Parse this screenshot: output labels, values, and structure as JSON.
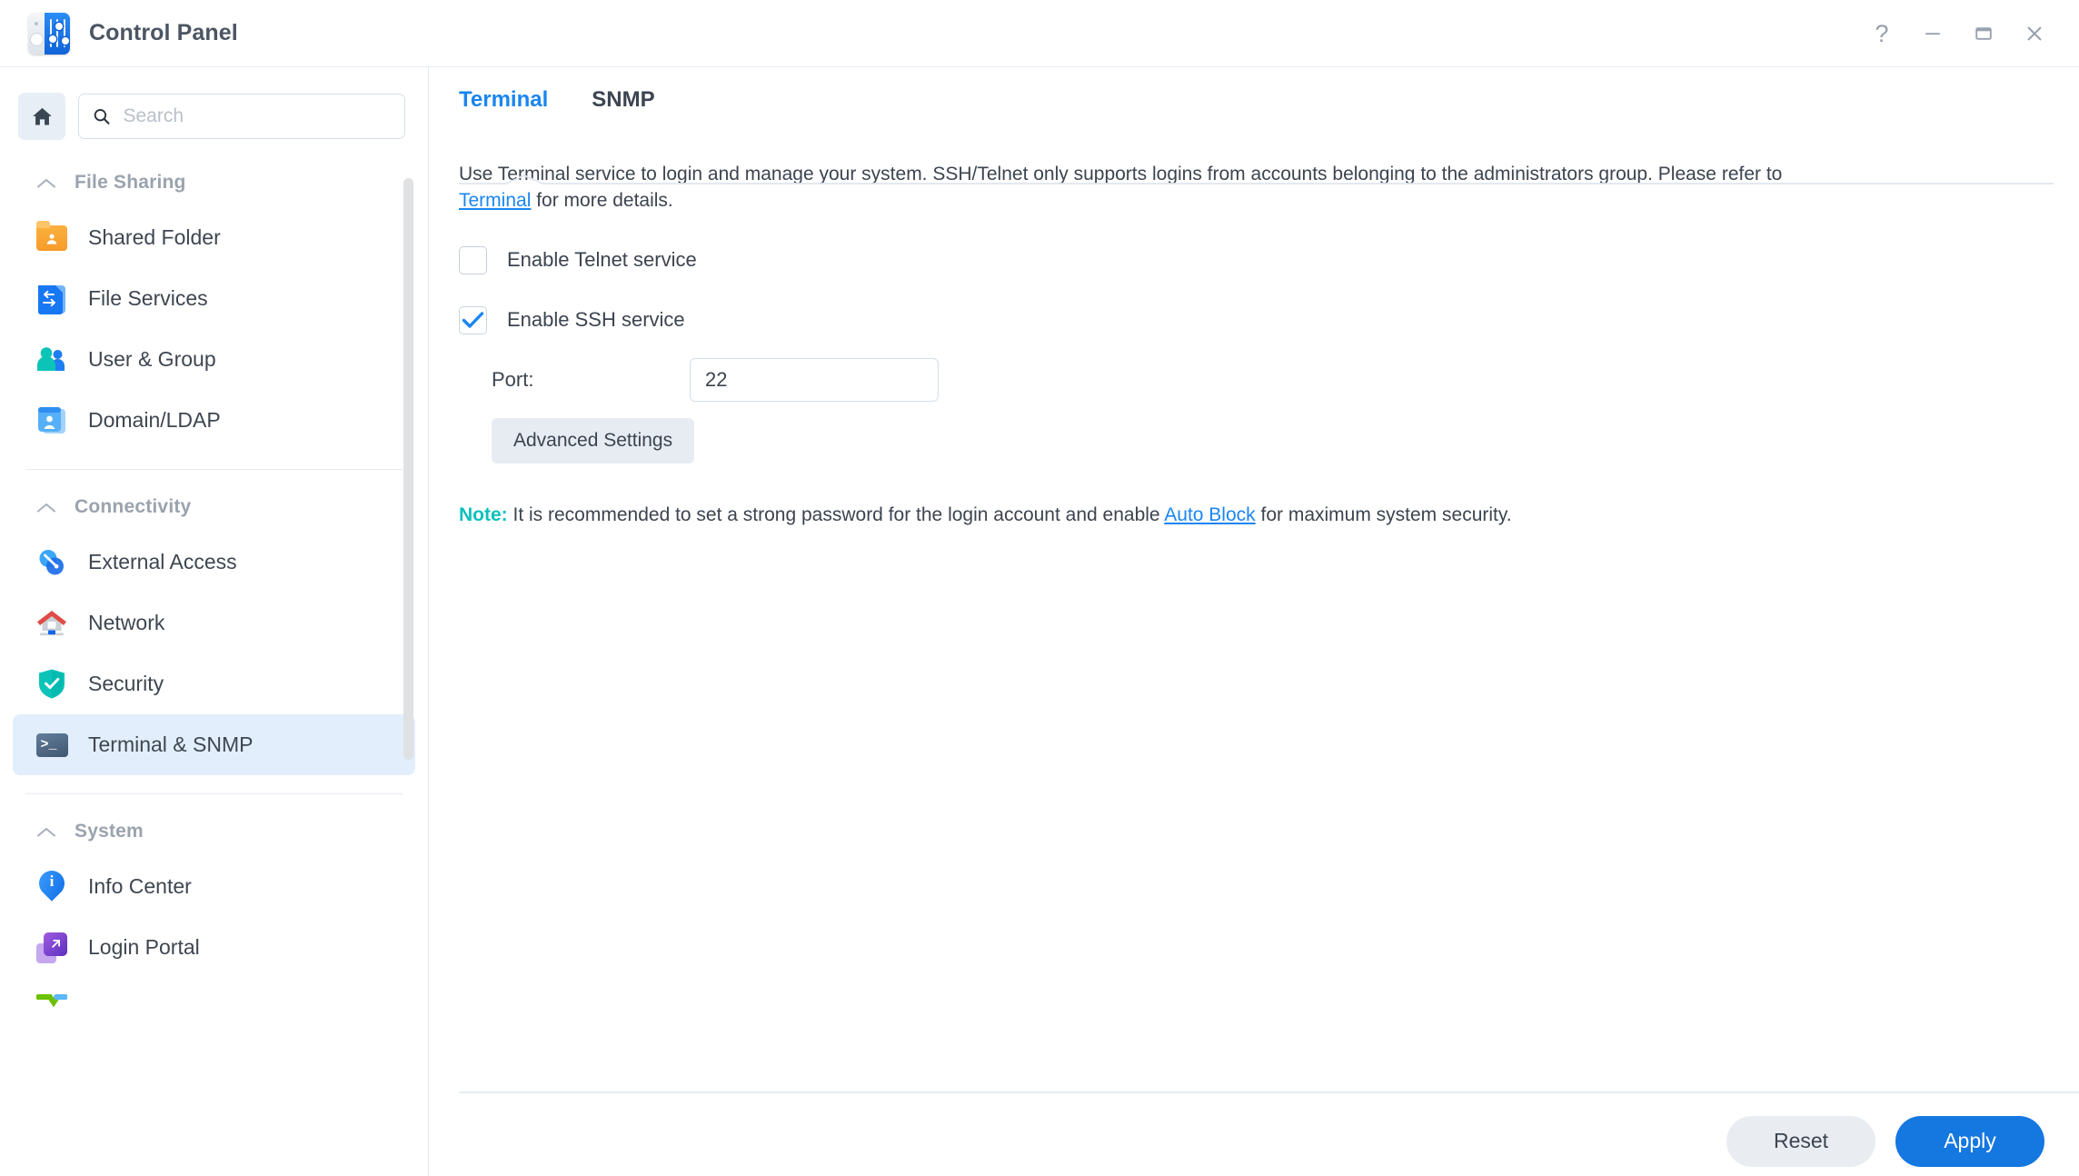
{
  "window": {
    "title": "Control Panel",
    "icon": "control-panel-icon",
    "controls": [
      {
        "name": "help-button",
        "glyph": "?"
      },
      {
        "name": "minimize-button",
        "glyph": "—"
      },
      {
        "name": "maximize-button",
        "glyph": "□"
      },
      {
        "name": "close-button",
        "glyph": "✕"
      }
    ]
  },
  "sidebar": {
    "home_button": "home-icon",
    "search": {
      "placeholder": "Search",
      "value": "",
      "icon": "search-icon"
    },
    "groups": [
      {
        "label": "File Sharing",
        "collapse_icon": "chevron-up-icon",
        "items": [
          {
            "label": "Shared Folder",
            "icon": "shared-folder-icon",
            "active": false
          },
          {
            "label": "File Services",
            "icon": "file-services-icon",
            "active": false
          },
          {
            "label": "User & Group",
            "icon": "user-group-icon",
            "active": false
          },
          {
            "label": "Domain/LDAP",
            "icon": "domain-ldap-icon",
            "active": false
          }
        ]
      },
      {
        "label": "Connectivity",
        "collapse_icon": "chevron-up-icon",
        "items": [
          {
            "label": "External Access",
            "icon": "external-access-icon",
            "active": false
          },
          {
            "label": "Network",
            "icon": "network-icon",
            "active": false
          },
          {
            "label": "Security",
            "icon": "security-shield-icon",
            "active": false
          },
          {
            "label": "Terminal & SNMP",
            "icon": "terminal-icon",
            "active": true
          }
        ]
      },
      {
        "label": "System",
        "collapse_icon": "chevron-up-icon",
        "items": [
          {
            "label": "Info Center",
            "icon": "info-center-icon",
            "active": false
          },
          {
            "label": "Login Portal",
            "icon": "login-portal-icon",
            "active": false
          }
        ]
      }
    ]
  },
  "main": {
    "tabs": [
      {
        "label": "Terminal",
        "active": true
      },
      {
        "label": "SNMP",
        "active": false
      }
    ],
    "description": {
      "part1": "Use Terminal service to login and manage your system. SSH/Telnet only supports logins from accounts belonging to the administrators group. Please refer to ",
      "link": "Terminal",
      "part2": " for more details."
    },
    "telnet": {
      "label": "Enable Telnet service",
      "checked": false
    },
    "ssh": {
      "label": "Enable SSH service",
      "checked": true
    },
    "port": {
      "label": "Port:",
      "value": "22"
    },
    "advanced_settings_label": "Advanced Settings",
    "note": {
      "tag": "Note:",
      "part1": " It is recommended to set a strong password for the login account and enable ",
      "link": "Auto Block",
      "part2": " for maximum system security."
    },
    "footer": {
      "reset_label": "Reset",
      "apply_label": "Apply"
    }
  },
  "colors": {
    "accent_blue": "#1a86f0",
    "apply_blue": "#1577e0",
    "note_teal": "#0cc0bb",
    "active_nav_bg": "#e2eefb",
    "text_primary": "#3c444f",
    "text_muted": "#9aa3ad"
  }
}
